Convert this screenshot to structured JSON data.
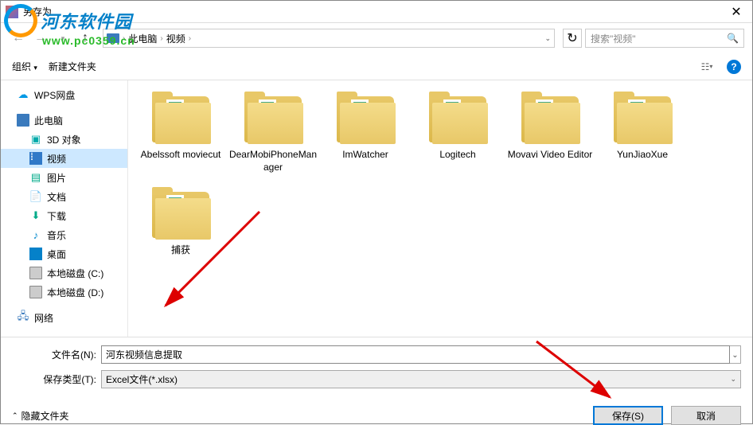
{
  "window": {
    "title": "另存为"
  },
  "nav": {
    "breadcrumb": [
      "此电脑",
      "视频"
    ],
    "search_placeholder": "搜索\"视频\""
  },
  "toolbar": {
    "organize": "组织",
    "new_folder": "新建文件夹"
  },
  "sidebar": {
    "items": [
      {
        "label": "WPS网盘",
        "icon": "wps",
        "sub": false
      },
      {
        "label": "此电脑",
        "icon": "pc",
        "sub": false
      },
      {
        "label": "3D 对象",
        "icon": "3d",
        "sub": true
      },
      {
        "label": "视频",
        "icon": "video",
        "sub": true,
        "selected": true
      },
      {
        "label": "图片",
        "icon": "pic",
        "sub": true
      },
      {
        "label": "文档",
        "icon": "doc",
        "sub": true
      },
      {
        "label": "下载",
        "icon": "dl",
        "sub": true
      },
      {
        "label": "音乐",
        "icon": "music",
        "sub": true
      },
      {
        "label": "桌面",
        "icon": "desk",
        "sub": true
      },
      {
        "label": "本地磁盘 (C:)",
        "icon": "disk",
        "sub": true
      },
      {
        "label": "本地磁盘 (D:)",
        "icon": "disk",
        "sub": true
      },
      {
        "label": "网络",
        "icon": "net",
        "sub": false
      }
    ]
  },
  "folders": [
    {
      "name": "Abelssoft moviecut"
    },
    {
      "name": "DearMobiPhoneManager"
    },
    {
      "name": "ImWatcher"
    },
    {
      "name": "Logitech"
    },
    {
      "name": "Movavi Video Editor"
    },
    {
      "name": "YunJiaoXue"
    },
    {
      "name": "捕获"
    }
  ],
  "fields": {
    "filename_label": "文件名(N):",
    "filename_value": "河东视频信息提取",
    "filetype_label": "保存类型(T):",
    "filetype_value": "Excel文件(*.xlsx)"
  },
  "footer": {
    "hide_folders": "隐藏文件夹",
    "save": "保存(S)",
    "cancel": "取消"
  },
  "watermark": {
    "title": "河东软件园",
    "url": "www.pc0359.cn"
  }
}
